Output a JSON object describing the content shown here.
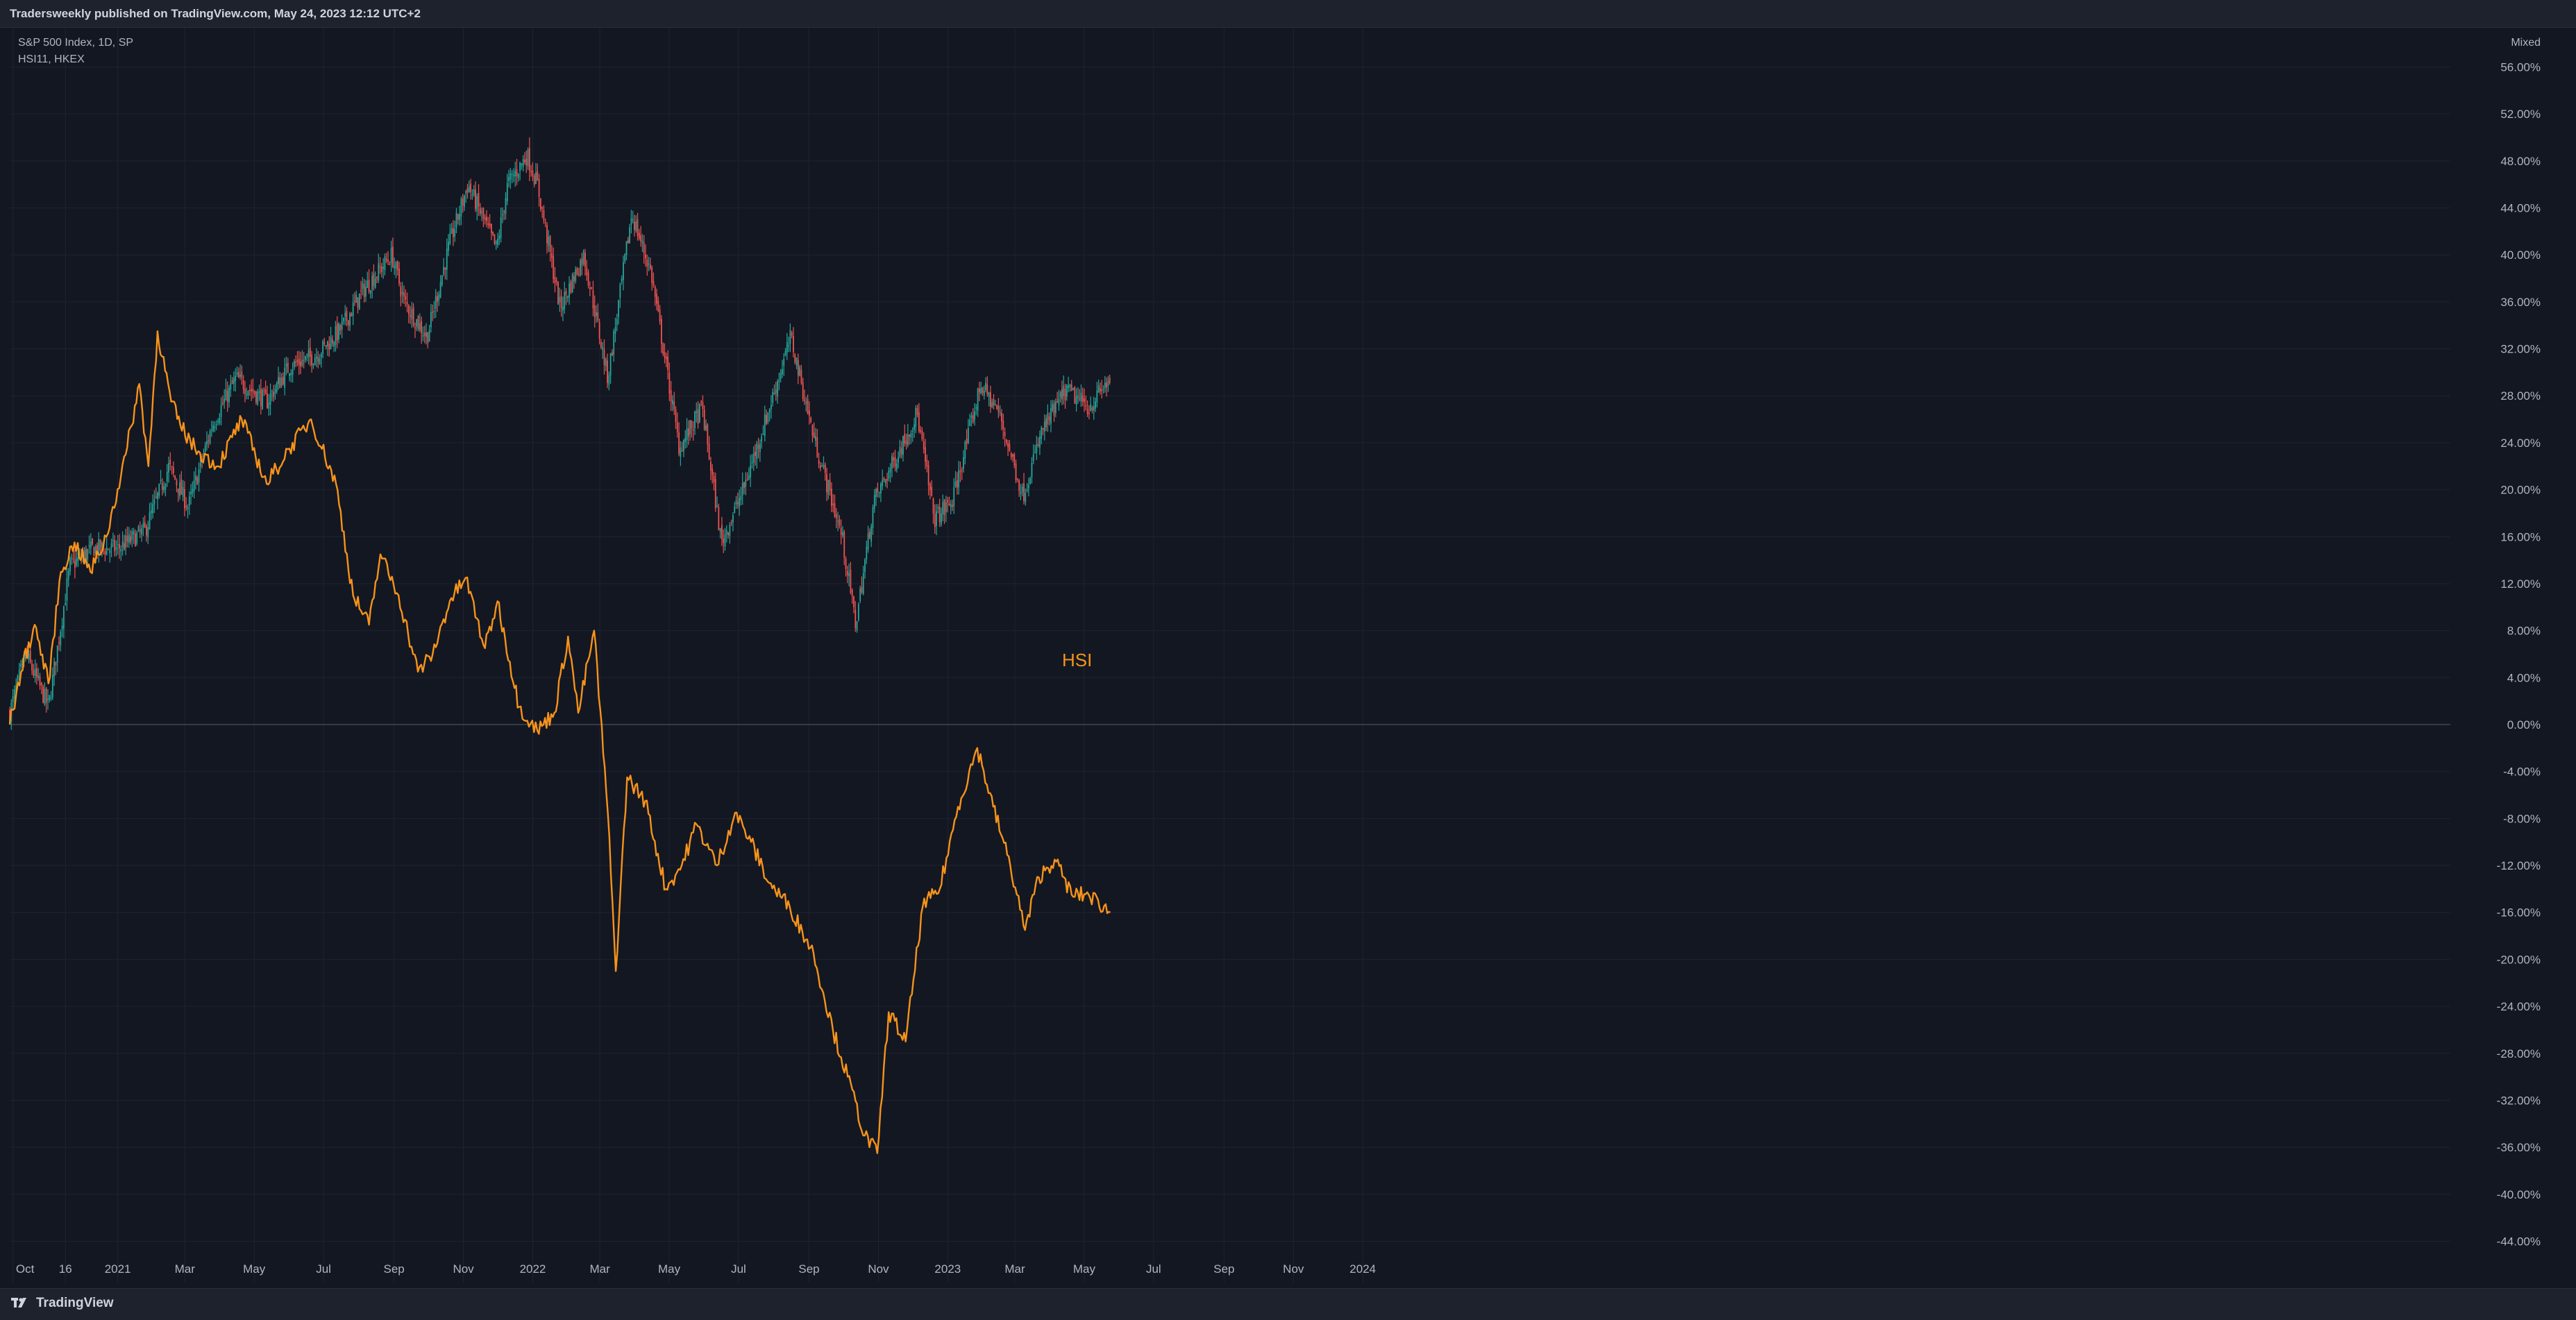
{
  "header": {
    "text": "Tradersweekly published on TradingView.com, May 24, 2023 12:12 UTC+2"
  },
  "legend": {
    "line1": "S&P 500 Index, 1D, SP",
    "line2": "HSI11, HKEX"
  },
  "footer": {
    "brand_text": "TradingView"
  },
  "colors": {
    "background": "#131722",
    "candle_up": "#26a69a",
    "candle_down": "#ef5350",
    "hsi_line": "#f7931a",
    "grid": "#1f2330",
    "zero_line": "#434651",
    "axis_text": "#b2b5be"
  },
  "chart_data": [
    {
      "type": "line",
      "title": "",
      "price_scale_mode": "Mixed",
      "y_unit": "percent",
      "ylim": [
        -45,
        58
      ],
      "y_ticks": [
        "56.00%",
        "52.00%",
        "48.00%",
        "44.00%",
        "40.00%",
        "36.00%",
        "32.00%",
        "28.00%",
        "24.00%",
        "20.00%",
        "16.00%",
        "12.00%",
        "8.00%",
        "4.00%",
        "0.00%",
        "-4.00%",
        "-8.00%",
        "-12.00%",
        "-16.00%",
        "-20.00%",
        "-24.00%",
        "-28.00%",
        "-32.00%",
        "-36.00%",
        "-40.00%",
        "-44.00%"
      ],
      "x_ticks": [
        "Oct",
        "16",
        "2021",
        "Mar",
        "May",
        "Jul",
        "Sep",
        "Nov",
        "2022",
        "Mar",
        "May",
        "Jul",
        "Sep",
        "Nov",
        "2023",
        "Mar",
        "May",
        "Jul",
        "Sep",
        "Nov",
        "2024"
      ],
      "grid": true,
      "series": [
        {
          "name": "S&P 500 Index, 1D, SP",
          "style": "candlestick",
          "x": [
            "2020-09-28",
            "2020-10-12",
            "2020-11-01",
            "2020-11-20",
            "2020-12-10",
            "2021-01-01",
            "2021-01-25",
            "2021-02-15",
            "2021-03-04",
            "2021-03-25",
            "2021-04-15",
            "2021-05-12",
            "2021-06-01",
            "2021-06-25",
            "2021-07-15",
            "2021-08-05",
            "2021-08-30",
            "2021-09-10",
            "2021-09-30",
            "2021-10-20",
            "2021-11-05",
            "2021-11-30",
            "2021-12-10",
            "2021-12-27",
            "2022-01-05",
            "2022-01-25",
            "2022-02-15",
            "2022-03-08",
            "2022-03-29",
            "2022-04-15",
            "2022-05-10",
            "2022-05-30",
            "2022-06-16",
            "2022-07-05",
            "2022-07-25",
            "2022-08-16",
            "2022-09-05",
            "2022-09-30",
            "2022-10-12",
            "2022-10-28",
            "2022-11-15",
            "2022-12-05",
            "2022-12-20",
            "2023-01-05",
            "2023-01-30",
            "2023-02-15",
            "2023-03-08",
            "2023-03-25",
            "2023-04-15",
            "2023-05-05",
            "2023-05-24"
          ],
          "values": [
            1.0,
            6.0,
            1.5,
            13.5,
            15.0,
            15.0,
            16.5,
            22.0,
            18.5,
            25.5,
            29.5,
            27.5,
            30.5,
            31.5,
            33.5,
            37.0,
            40.0,
            36.0,
            33.0,
            41.0,
            46.0,
            40.5,
            46.0,
            48.5,
            46.0,
            35.5,
            40.0,
            29.5,
            43.5,
            38.5,
            23.5,
            27.0,
            15.5,
            20.0,
            26.0,
            33.0,
            24.5,
            16.0,
            8.5,
            19.0,
            22.5,
            26.5,
            17.5,
            19.0,
            29.0,
            26.5,
            19.5,
            25.0,
            28.5,
            27.0,
            29.5
          ]
        },
        {
          "name": "HSI",
          "style": "line",
          "x": [
            "2020-09-28",
            "2020-10-08",
            "2020-10-20",
            "2020-11-01",
            "2020-11-12",
            "2020-11-24",
            "2020-12-08",
            "2020-12-22",
            "2021-01-08",
            "2021-01-20",
            "2021-01-28",
            "2021-02-05",
            "2021-02-17",
            "2021-02-25",
            "2021-03-10",
            "2021-03-30",
            "2021-04-20",
            "2021-05-12",
            "2021-06-01",
            "2021-06-20",
            "2021-07-12",
            "2021-07-27",
            "2021-08-10",
            "2021-08-20",
            "2021-09-05",
            "2021-09-22",
            "2021-10-05",
            "2021-10-20",
            "2021-11-03",
            "2021-11-20",
            "2021-12-01",
            "2021-12-20",
            "2022-01-05",
            "2022-01-20",
            "2022-02-01",
            "2022-02-10",
            "2022-02-24",
            "2022-03-08",
            "2022-03-15",
            "2022-03-25",
            "2022-04-10",
            "2022-04-28",
            "2022-05-12",
            "2022-05-25",
            "2022-06-12",
            "2022-06-28",
            "2022-07-12",
            "2022-07-28",
            "2022-08-15",
            "2022-09-05",
            "2022-09-22",
            "2022-10-05",
            "2022-10-20",
            "2022-10-31",
            "2022-11-10",
            "2022-11-25",
            "2022-12-10",
            "2022-12-25",
            "2023-01-10",
            "2023-01-27",
            "2023-02-10",
            "2023-02-25",
            "2023-03-10",
            "2023-03-22",
            "2023-04-05",
            "2023-04-20",
            "2023-05-05",
            "2023-05-24"
          ],
          "values": [
            0.0,
            4.5,
            8.5,
            3.5,
            13.0,
            15.5,
            13.0,
            16.0,
            23.0,
            29.0,
            22.0,
            33.5,
            27.5,
            25.5,
            23.5,
            22.0,
            26.0,
            20.5,
            23.5,
            26.0,
            20.5,
            11.0,
            8.5,
            14.5,
            11.0,
            4.5,
            6.0,
            10.5,
            12.5,
            6.5,
            10.5,
            1.5,
            -0.5,
            1.0,
            7.5,
            1.0,
            8.0,
            -7.5,
            -21.0,
            -4.5,
            -6.5,
            -14.0,
            -12.0,
            -8.5,
            -12.0,
            -7.5,
            -10.0,
            -13.5,
            -15.5,
            -19.5,
            -26.0,
            -30.0,
            -35.0,
            -36.5,
            -24.5,
            -27.0,
            -15.5,
            -14.0,
            -7.0,
            -2.0,
            -7.0,
            -12.0,
            -17.5,
            -13.0,
            -11.5,
            -14.5,
            -14.5,
            -16.0
          ]
        }
      ],
      "annotations": [
        "HSI"
      ]
    }
  ]
}
